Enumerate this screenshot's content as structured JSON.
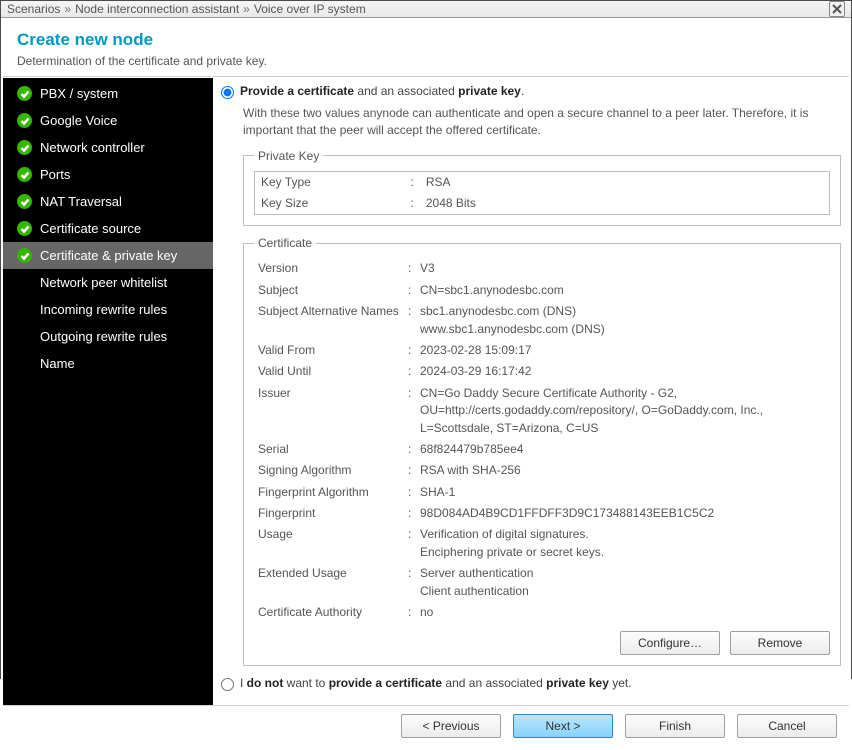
{
  "breadcrumb": [
    "Scenarios",
    "Node interconnection assistant",
    "Voice over IP system"
  ],
  "page": {
    "title": "Create new node",
    "subtitle": "Determination of the certificate and private key."
  },
  "sidebar": {
    "items": [
      {
        "label": "PBX / system",
        "done": true,
        "selected": false
      },
      {
        "label": "Google Voice",
        "done": true,
        "selected": false
      },
      {
        "label": "Network controller",
        "done": true,
        "selected": false
      },
      {
        "label": "Ports",
        "done": true,
        "selected": false
      },
      {
        "label": "NAT Traversal",
        "done": true,
        "selected": false
      },
      {
        "label": "Certificate source",
        "done": true,
        "selected": false
      },
      {
        "label": "Certificate & private key",
        "done": true,
        "selected": true
      },
      {
        "label": "Network peer whitelist",
        "done": false,
        "selected": false
      },
      {
        "label": "Incoming rewrite rules",
        "done": false,
        "selected": false
      },
      {
        "label": "Outgoing rewrite rules",
        "done": false,
        "selected": false
      },
      {
        "label": "Name",
        "done": false,
        "selected": false
      }
    ]
  },
  "options": {
    "provide": {
      "pre": "Provide a certificate",
      "mid": " and an associated ",
      "post": "private key",
      "tail": ".",
      "desc": "With these two values anynode can authenticate and open a secure channel to a peer later. Therefore, it is important that the peer will accept the offered certificate."
    },
    "not_provide": {
      "a": "I ",
      "b": "do not",
      "c": " want to ",
      "d": "provide a certificate",
      "e": " and an associated ",
      "f": "private key",
      "g": " yet."
    }
  },
  "private_key": {
    "legend": "Private Key",
    "rows": [
      {
        "k": "Key Type",
        "v": "RSA"
      },
      {
        "k": "Key Size",
        "v": "2048 Bits"
      }
    ]
  },
  "certificate": {
    "legend": "Certificate",
    "rows": [
      {
        "k": "Version",
        "v": "V3"
      },
      {
        "k": "Subject",
        "v": "CN=sbc1.anynodesbc.com"
      },
      {
        "k": "Subject Alternative Names",
        "v": "sbc1.anynodesbc.com (DNS)\nwww.sbc1.anynodesbc.com (DNS)"
      },
      {
        "k": "Valid From",
        "v": "2023-02-28 15:09:17"
      },
      {
        "k": "Valid Until",
        "v": "2024-03-29 16:17:42"
      },
      {
        "k": "Issuer",
        "v": "CN=Go Daddy Secure Certificate Authority - G2, OU=http://certs.godaddy.com/repository/, O=GoDaddy.com, Inc., L=Scottsdale, ST=Arizona, C=US"
      },
      {
        "k": "Serial",
        "v": "68f824479b785ee4"
      },
      {
        "k": "Signing Algorithm",
        "v": "RSA with SHA-256"
      },
      {
        "k": "Fingerprint Algorithm",
        "v": "SHA-1"
      },
      {
        "k": "Fingerprint",
        "v": "98D084AD4B9CD1FFDFF3D9C173488143EEB1C5C2"
      },
      {
        "k": "Usage",
        "v": "Verification of digital signatures.\nEnciphering private or secret keys."
      },
      {
        "k": "Extended Usage",
        "v": "Server authentication\nClient authentication"
      },
      {
        "k": "Certificate Authority",
        "v": "no"
      }
    ]
  },
  "buttons": {
    "configure": "Configure…",
    "remove": "Remove",
    "previous": "< Previous",
    "next": "Next >",
    "finish": "Finish",
    "cancel": "Cancel"
  }
}
